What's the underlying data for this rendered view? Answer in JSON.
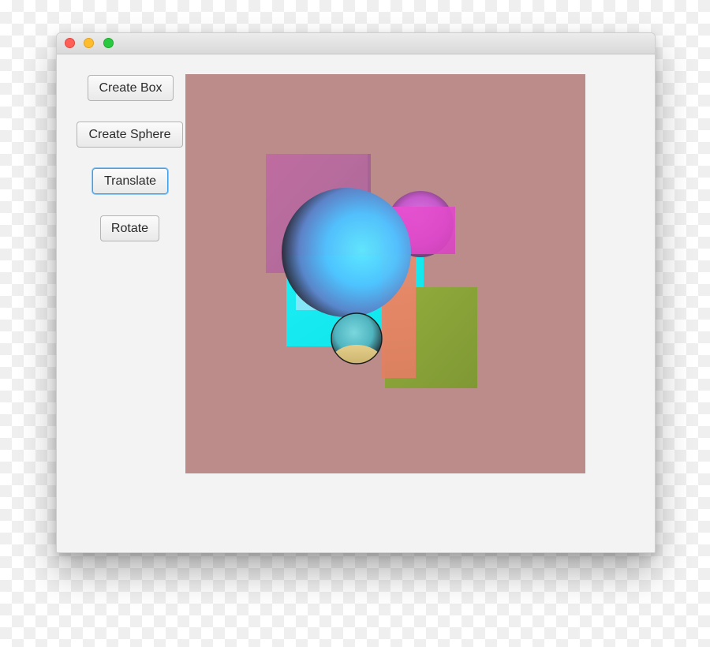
{
  "window": {
    "traffic_lights": [
      {
        "name": "close",
        "color": "#ff5f57"
      },
      {
        "name": "minimize",
        "color": "#ffbd2e"
      },
      {
        "name": "zoom",
        "color": "#28c940"
      }
    ]
  },
  "toolbar": {
    "create_box_label": "Create Box",
    "create_sphere_label": "Create Sphere",
    "translate_label": "Translate",
    "rotate_label": "Rotate",
    "focused_button": "Translate"
  },
  "scene": {
    "background_color": "#bb8c8a",
    "shapes": [
      {
        "kind": "box",
        "color": "#b96a9e"
      },
      {
        "kind": "box",
        "color": "#13eaf0"
      },
      {
        "kind": "box",
        "color": "#8ba33a"
      },
      {
        "kind": "box",
        "color": "#e98768"
      },
      {
        "kind": "box",
        "color": "#e34ccc"
      },
      {
        "kind": "sphere",
        "color": "#4fd0ff"
      },
      {
        "kind": "sphere",
        "color": "#d24fd6"
      },
      {
        "kind": "sphere",
        "color": "#5ec3cf"
      }
    ]
  }
}
